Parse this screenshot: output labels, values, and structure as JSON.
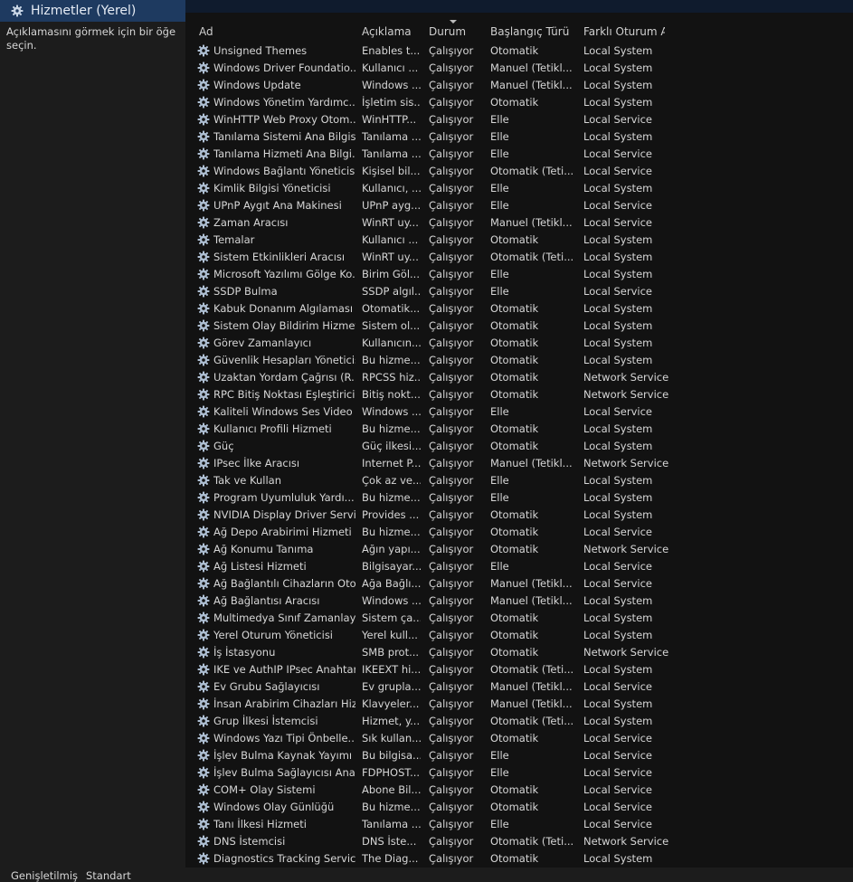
{
  "window": {
    "title": "Hizmetler (Yerel)",
    "icon": "services-gear-icon"
  },
  "left_pane": {
    "description": "Açıklamasını görmek için bir öğe seçin."
  },
  "columns": {
    "name": "Ad",
    "description": "Açıklama",
    "status": "Durum",
    "startup": "Başlangıç Türü",
    "logon": "Farklı Oturum Aç"
  },
  "services": [
    {
      "name": "Unsigned Themes",
      "description": "Enables t...",
      "status": "Çalışıyor",
      "startup": "Otomatik",
      "logon": "Local System"
    },
    {
      "name": "Windows Driver Foundatio...",
      "description": "Kullanıcı ...",
      "status": "Çalışıyor",
      "startup": "Manuel (Tetikl...",
      "logon": "Local System"
    },
    {
      "name": "Windows Update",
      "description": "Windows ...",
      "status": "Çalışıyor",
      "startup": "Manuel (Tetikl...",
      "logon": "Local System"
    },
    {
      "name": "Windows Yönetim Yardımc...",
      "description": "İşletim sis...",
      "status": "Çalışıyor",
      "startup": "Otomatik",
      "logon": "Local System"
    },
    {
      "name": "WinHTTP Web Proxy Otom...",
      "description": "WinHTTP...",
      "status": "Çalışıyor",
      "startup": "Elle",
      "logon": "Local Service"
    },
    {
      "name": "Tanılama Sistemi Ana Bilgis...",
      "description": "Tanılama ...",
      "status": "Çalışıyor",
      "startup": "Elle",
      "logon": "Local System"
    },
    {
      "name": "Tanılama Hizmeti Ana Bilgi...",
      "description": "Tanılama ...",
      "status": "Çalışıyor",
      "startup": "Elle",
      "logon": "Local Service"
    },
    {
      "name": "Windows Bağlantı Yöneticisi",
      "description": "Kişisel bil...",
      "status": "Çalışıyor",
      "startup": "Otomatik (Teti...",
      "logon": "Local Service"
    },
    {
      "name": "Kimlik Bilgisi Yöneticisi",
      "description": "Kullanıcı, ...",
      "status": "Çalışıyor",
      "startup": "Elle",
      "logon": "Local System"
    },
    {
      "name": "UPnP Aygıt Ana Makinesi",
      "description": "UPnP ayg...",
      "status": "Çalışıyor",
      "startup": "Elle",
      "logon": "Local Service"
    },
    {
      "name": "Zaman Aracısı",
      "description": "WinRT uy...",
      "status": "Çalışıyor",
      "startup": "Manuel (Tetikl...",
      "logon": "Local Service"
    },
    {
      "name": "Temalar",
      "description": "Kullanıcı ...",
      "status": "Çalışıyor",
      "startup": "Otomatik",
      "logon": "Local System"
    },
    {
      "name": "Sistem Etkinlikleri Aracısı",
      "description": "WinRT uy...",
      "status": "Çalışıyor",
      "startup": "Otomatik (Teti...",
      "logon": "Local System"
    },
    {
      "name": "Microsoft Yazılımı Gölge Ko...",
      "description": "Birim Göl...",
      "status": "Çalışıyor",
      "startup": "Elle",
      "logon": "Local System"
    },
    {
      "name": "SSDP Bulma",
      "description": "SSDP algıl...",
      "status": "Çalışıyor",
      "startup": "Elle",
      "logon": "Local Service"
    },
    {
      "name": "Kabuk Donanım Algılaması",
      "description": "Otomatik...",
      "status": "Çalışıyor",
      "startup": "Otomatik",
      "logon": "Local System"
    },
    {
      "name": "Sistem Olay Bildirim Hizmeti",
      "description": "Sistem ol...",
      "status": "Çalışıyor",
      "startup": "Otomatik",
      "logon": "Local System"
    },
    {
      "name": "Görev Zamanlayıcı",
      "description": "Kullanıcın...",
      "status": "Çalışıyor",
      "startup": "Otomatik",
      "logon": "Local System"
    },
    {
      "name": "Güvenlik Hesapları Yöneticisi",
      "description": "Bu hizme...",
      "status": "Çalışıyor",
      "startup": "Otomatik",
      "logon": "Local System"
    },
    {
      "name": "Uzaktan Yordam Çağrısı (R...",
      "description": "RPCSS hiz...",
      "status": "Çalışıyor",
      "startup": "Otomatik",
      "logon": "Network Service"
    },
    {
      "name": "RPC Bitiş Noktası Eşleştiricisi",
      "description": "Bitiş nokt...",
      "status": "Çalışıyor",
      "startup": "Otomatik",
      "logon": "Network Service"
    },
    {
      "name": "Kaliteli Windows Ses Video ...",
      "description": "Windows ...",
      "status": "Çalışıyor",
      "startup": "Elle",
      "logon": "Local Service"
    },
    {
      "name": "Kullanıcı Profili Hizmeti",
      "description": "Bu hizme...",
      "status": "Çalışıyor",
      "startup": "Otomatik",
      "logon": "Local System"
    },
    {
      "name": "Güç",
      "description": "Güç ilkesi...",
      "status": "Çalışıyor",
      "startup": "Otomatik",
      "logon": "Local System"
    },
    {
      "name": "IPsec İlke Aracısı",
      "description": "Internet P...",
      "status": "Çalışıyor",
      "startup": "Manuel (Tetikl...",
      "logon": "Network Service"
    },
    {
      "name": "Tak ve Kullan",
      "description": "Çok az ve...",
      "status": "Çalışıyor",
      "startup": "Elle",
      "logon": "Local System"
    },
    {
      "name": "Program Uyumluluk Yardı...",
      "description": "Bu hizme...",
      "status": "Çalışıyor",
      "startup": "Elle",
      "logon": "Local System"
    },
    {
      "name": "NVIDIA Display Driver Service",
      "description": "Provides ...",
      "status": "Çalışıyor",
      "startup": "Otomatik",
      "logon": "Local System"
    },
    {
      "name": "Ağ Depo Arabirimi Hizmeti",
      "description": "Bu hizme...",
      "status": "Çalışıyor",
      "startup": "Otomatik",
      "logon": "Local Service"
    },
    {
      "name": "Ağ Konumu Tanıma",
      "description": "Ağın yapı...",
      "status": "Çalışıyor",
      "startup": "Otomatik",
      "logon": "Network Service"
    },
    {
      "name": "Ağ Listesi Hizmeti",
      "description": "Bilgisayar...",
      "status": "Çalışıyor",
      "startup": "Elle",
      "logon": "Local Service"
    },
    {
      "name": "Ağ Bağlantılı Cihazların Oto...",
      "description": "Ağa Bağlı...",
      "status": "Çalışıyor",
      "startup": "Manuel (Tetikl...",
      "logon": "Local Service"
    },
    {
      "name": "Ağ Bağlantısı Aracısı",
      "description": "Windows ...",
      "status": "Çalışıyor",
      "startup": "Manuel (Tetikl...",
      "logon": "Local System"
    },
    {
      "name": "Multimedya Sınıf Zamanlay...",
      "description": "Sistem ça...",
      "status": "Çalışıyor",
      "startup": "Otomatik",
      "logon": "Local System"
    },
    {
      "name": "Yerel Oturum Yöneticisi",
      "description": "Yerel kull...",
      "status": "Çalışıyor",
      "startup": "Otomatik",
      "logon": "Local System"
    },
    {
      "name": "İş İstasyonu",
      "description": "SMB prot...",
      "status": "Çalışıyor",
      "startup": "Otomatik",
      "logon": "Network Service"
    },
    {
      "name": "IKE ve AuthIP IPsec Anahtar...",
      "description": "IKEEXT hi...",
      "status": "Çalışıyor",
      "startup": "Otomatik (Teti...",
      "logon": "Local System"
    },
    {
      "name": "Ev Grubu Sağlayıcısı",
      "description": "Ev grupla...",
      "status": "Çalışıyor",
      "startup": "Manuel (Tetikl...",
      "logon": "Local Service"
    },
    {
      "name": "İnsan Arabirim Cihazları Hiz...",
      "description": "Klavyeler...",
      "status": "Çalışıyor",
      "startup": "Manuel (Tetikl...",
      "logon": "Local System"
    },
    {
      "name": "Grup İlkesi İstemcisi",
      "description": "Hizmet, y...",
      "status": "Çalışıyor",
      "startup": "Otomatik (Teti...",
      "logon": "Local System"
    },
    {
      "name": "Windows Yazı Tipi Önbelle...",
      "description": "Sık kullan...",
      "status": "Çalışıyor",
      "startup": "Otomatik",
      "logon": "Local Service"
    },
    {
      "name": "İşlev Bulma Kaynak Yayımı",
      "description": "Bu bilgisa...",
      "status": "Çalışıyor",
      "startup": "Elle",
      "logon": "Local Service"
    },
    {
      "name": "İşlev Bulma Sağlayıcısı Ana ...",
      "description": "FDPHOST...",
      "status": "Çalışıyor",
      "startup": "Elle",
      "logon": "Local Service"
    },
    {
      "name": "COM+ Olay Sistemi",
      "description": "Abone Bil...",
      "status": "Çalışıyor",
      "startup": "Otomatik",
      "logon": "Local Service"
    },
    {
      "name": "Windows Olay Günlüğü",
      "description": "Bu hizme...",
      "status": "Çalışıyor",
      "startup": "Otomatik",
      "logon": "Local Service"
    },
    {
      "name": "Tanı İlkesi Hizmeti",
      "description": "Tanılama ...",
      "status": "Çalışıyor",
      "startup": "Elle",
      "logon": "Local Service"
    },
    {
      "name": "DNS İstemcisi",
      "description": "DNS İste...",
      "status": "Çalışıyor",
      "startup": "Otomatik (Teti...",
      "logon": "Network Service"
    },
    {
      "name": "Diagnostics Tracking Service",
      "description": "The Diag...",
      "status": "Çalışıyor",
      "startup": "Otomatik",
      "logon": "Local System"
    }
  ],
  "bottom_tabs": {
    "extended": "Genişletilmiş",
    "standard": "Standart"
  }
}
